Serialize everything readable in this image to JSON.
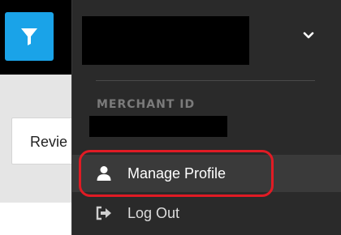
{
  "header": {
    "filter_icon": "filter-icon",
    "accent_color": "#1aa3e8"
  },
  "page": {
    "review_tab_label": "Revie"
  },
  "profile_menu": {
    "chevron_icon": "chevron-down-icon",
    "merchant_id_label": "MERCHANT ID",
    "items": [
      {
        "label": "Manage Profile",
        "icon": "user-icon",
        "highlighted": true
      },
      {
        "label": "Log Out",
        "icon": "sign-out-icon",
        "highlighted": false
      }
    ],
    "highlight_color": "#e01b24"
  }
}
